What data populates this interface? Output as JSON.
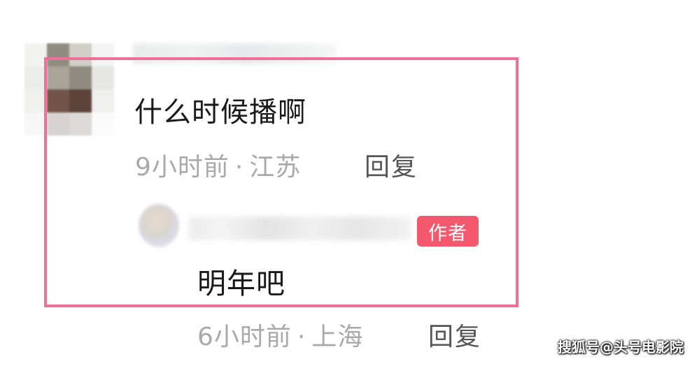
{
  "comment": {
    "text": "什么时候播啊",
    "time": "9小时前",
    "separator": "·",
    "location": "江苏",
    "reply_label": "回复"
  },
  "author_reply": {
    "badge": "作者",
    "text": "明年吧",
    "time": "6小时前",
    "separator": "·",
    "location": "上海",
    "reply_label": "回复"
  },
  "watermark": "搜狐号@头号电影院",
  "colors": {
    "highlight_frame": "#ee6f99",
    "author_badge": "#f3586d",
    "meta_text": "#a9a9a9",
    "body_text": "#1a1a1a"
  }
}
